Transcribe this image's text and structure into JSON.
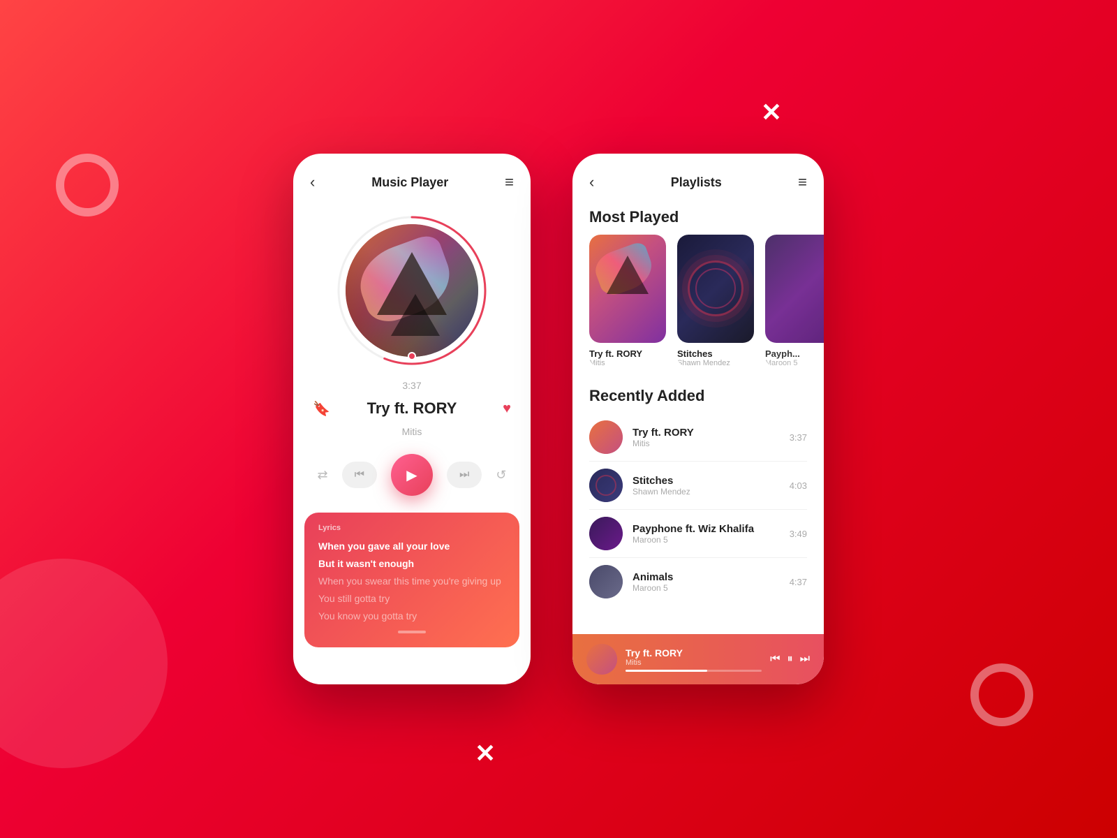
{
  "background": {
    "gradient": "linear-gradient(135deg, #f44 0%, #e03 40%, #c00 100%)"
  },
  "player": {
    "header_title": "Music Player",
    "back_label": "‹",
    "menu_label": "≡",
    "time_display": "3:37",
    "song_title": "Try ft. RORY",
    "song_artist": "Mitis",
    "lyrics_label": "Lyrics",
    "lyrics": [
      {
        "text": "When you gave all your love",
        "style": "bold"
      },
      {
        "text": "But it wasn't enough",
        "style": "bold"
      },
      {
        "text": "When you swear this time you're giving up",
        "style": "dim"
      },
      {
        "text": "You still gotta try",
        "style": "dim"
      },
      {
        "text": "You know you gotta try",
        "style": "dim"
      }
    ],
    "controls": {
      "shuffle": "⇄",
      "prev": "⏮",
      "play": "▶",
      "next": "⏭",
      "repeat": "↺"
    }
  },
  "playlists": {
    "header_title": "Playlists",
    "back_label": "‹",
    "menu_label": "≡",
    "most_played_title": "Most Played",
    "most_played": [
      {
        "title": "Try ft. RORY",
        "artist": "Mitis"
      },
      {
        "title": "Stitches",
        "artist": "Shawn Mendez"
      },
      {
        "title": "Payph...",
        "artist": "Maroon 5"
      }
    ],
    "recently_added_title": "Recently Added",
    "recently_added": [
      {
        "title": "Try ft. RORY",
        "artist": "Mitis",
        "duration": "3:37"
      },
      {
        "title": "Stitches",
        "artist": "Shawn Mendez",
        "duration": "4:03"
      },
      {
        "title": "Payphone ft. Wiz Khalifa",
        "artist": "Maroon 5",
        "duration": "3:49"
      },
      {
        "title": "Animals",
        "artist": "Maroon 5",
        "duration": "4:37"
      }
    ],
    "mini_player": {
      "title": "Try ft. RORY",
      "artist": "Mitis"
    }
  }
}
